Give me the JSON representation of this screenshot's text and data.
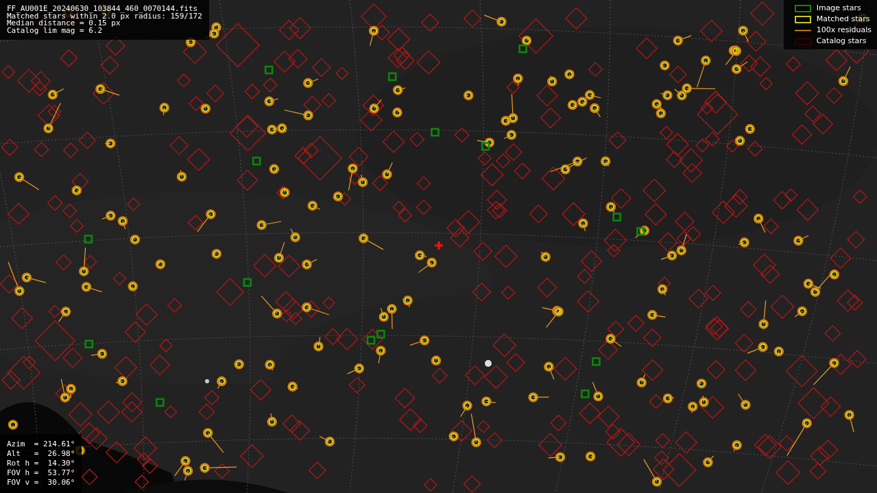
{
  "info": {
    "lines": [
      "FF_AU001E_20240630_103844_460_0070144.fits",
      "Matched stars within 2.0 px radius: 159/172",
      "Median distance = 0.15 px",
      "Catalog lim mag = 6.2"
    ]
  },
  "legend": [
    {
      "label": "Image stars"
    },
    {
      "kind": "matched",
      "label": "Matched stars"
    },
    {
      "kind": "residual",
      "label": "100x residuals"
    },
    {
      "kind": "catalog",
      "label": "Catalog stars"
    }
  ],
  "orientation": {
    "lines": [
      "Azim  = 214.61°",
      "Alt   =  26.98°",
      "Rot h =  14.30°",
      "FOV h =  53.77°",
      "FOV v =  30.06°"
    ]
  }
}
